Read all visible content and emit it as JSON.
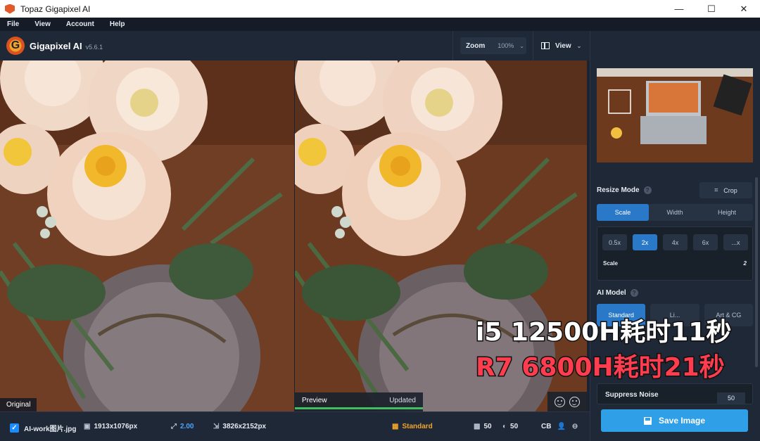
{
  "window": {
    "title": "Topaz Gigapixel AI",
    "controls": [
      "—",
      "☐",
      "✕"
    ]
  },
  "menu": [
    "File",
    "View",
    "Account",
    "Help"
  ],
  "toolbar": {
    "app_name": "Gigapixel AI",
    "version": "v5.6.1",
    "zoom_label": "Zoom",
    "zoom_value": "100%",
    "view_label": "View"
  },
  "panes": {
    "left_label": "Original",
    "preview_label": "Preview",
    "preview_status": "Updated",
    "preview_progress": 1.0
  },
  "bottom": {
    "filename": "AI-work图片.jpg",
    "input_size": "1913x1076px",
    "scale": "2.00",
    "output_size": "3826x2152px",
    "model": "Standard",
    "noise": "50",
    "blur": "50",
    "cb": "CB"
  },
  "sidebar": {
    "resize_mode_label": "Resize Mode",
    "crop_label": "Crop",
    "resize_tabs": [
      "Scale",
      "Width",
      "Height"
    ],
    "scale_options": [
      "0.5x",
      "2x",
      "4x",
      "6x",
      "...x"
    ],
    "scale_label": "Scale",
    "scale_value": "2",
    "ai_model_label": "AI Model",
    "models": [
      "Standard",
      "Li...",
      "Art & CG"
    ],
    "suppress_noise_label": "Suppress Noise",
    "suppress_noise_value": "50",
    "save_label": "Save Image"
  },
  "overlay": {
    "line1": "i5 12500H耗时11秒",
    "line2": "R7 6800H耗时21秒"
  },
  "colors": {
    "accent": "#2a79c9",
    "save": "#2f9fe8",
    "progress": "#3fbf62",
    "overlay_red": "#ff3d4f"
  }
}
